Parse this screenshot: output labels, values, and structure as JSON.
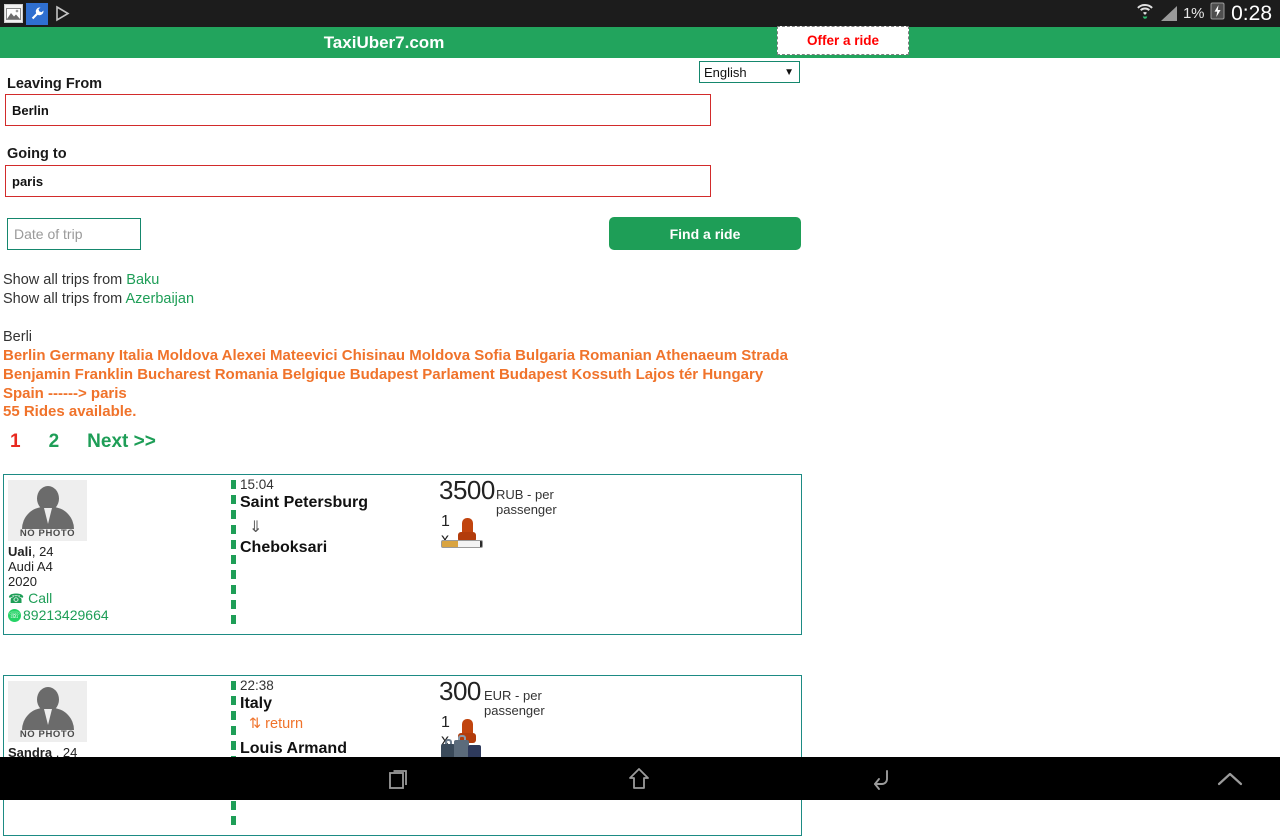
{
  "status_bar": {
    "icons": [
      "gallery-icon",
      "wrench-icon",
      "play-store-icon",
      "wifi-icon",
      "signal-icon"
    ],
    "battery_percent": "1%",
    "charging_icon": "bolt-icon",
    "clock": "0:28"
  },
  "header": {
    "title": "TaxiUber7.com",
    "offer_button": "Offer a ride",
    "bg_color": "#22a45d"
  },
  "search_form": {
    "language_value": "English",
    "leaving_from_label": "Leaving From",
    "leaving_from_value": "Berlin",
    "going_to_label": "Going to",
    "going_to_value": "paris",
    "date_placeholder": "Date of trip",
    "date_value": "",
    "find_button": "Find a ride"
  },
  "quick_links": [
    {
      "prefix": "Show all trips from ",
      "link": "Baku"
    },
    {
      "prefix": "Show all trips from ",
      "link": "Azerbaijan"
    }
  ],
  "results_summary": {
    "query_echo": "Berli",
    "route_description": "Berlin Germany Italia Moldova Alexei Mateevici Chisinau Moldova Sofia Bulgaria Romanian Athenaeum Strada Benjamin Franklin Bucharest Romania Belgique Budapest Parlament Budapest Kossuth Lajos tér Hungary Spain ------> paris",
    "rides_available": "55 Rides available.",
    "accent_color": "#f0732b"
  },
  "pagination": {
    "current": "1",
    "page_2": "2",
    "next": "Next >>",
    "current_color": "#e8291f",
    "link_color": "#1e9e57"
  },
  "rides": [
    {
      "driver": {
        "photo_placeholder": "NO PHOTO",
        "name": "Uali",
        "age": "24",
        "car": "Audi A4",
        "year": "2020",
        "call_label": "Call",
        "whatsapp_number": "89213429664"
      },
      "route": {
        "time": "15:04",
        "from": "Saint Petersburg",
        "to": "Cheboksari",
        "arrow": "⇓",
        "return_label": ""
      },
      "price": {
        "amount": "3500",
        "currency_note": "RUB - per passenger",
        "seats": "1 x",
        "seat_icon": "car-seat-icon",
        "extra_icon": "cigarette-icon"
      }
    },
    {
      "driver": {
        "photo_placeholder": "NO PHOTO",
        "name": "Sandra ",
        "age": "24",
        "car": "",
        "year": "",
        "call_label": "",
        "whatsapp_number": ""
      },
      "route": {
        "time": "22:38",
        "from": "Italy",
        "to": "Louis Armand",
        "arrow": "",
        "return_label": "⇅ return"
      },
      "price": {
        "amount": "300",
        "currency_note": "EUR - per passenger",
        "seats": "1 x",
        "seat_icon": "car-seat-icon",
        "extra_icon": "luggage-icon"
      }
    }
  ],
  "nav_bar": {
    "recent_label": "recent-apps-icon",
    "home_label": "home-icon",
    "back_label": "back-icon",
    "hide_label": "hide-navbar-icon"
  }
}
